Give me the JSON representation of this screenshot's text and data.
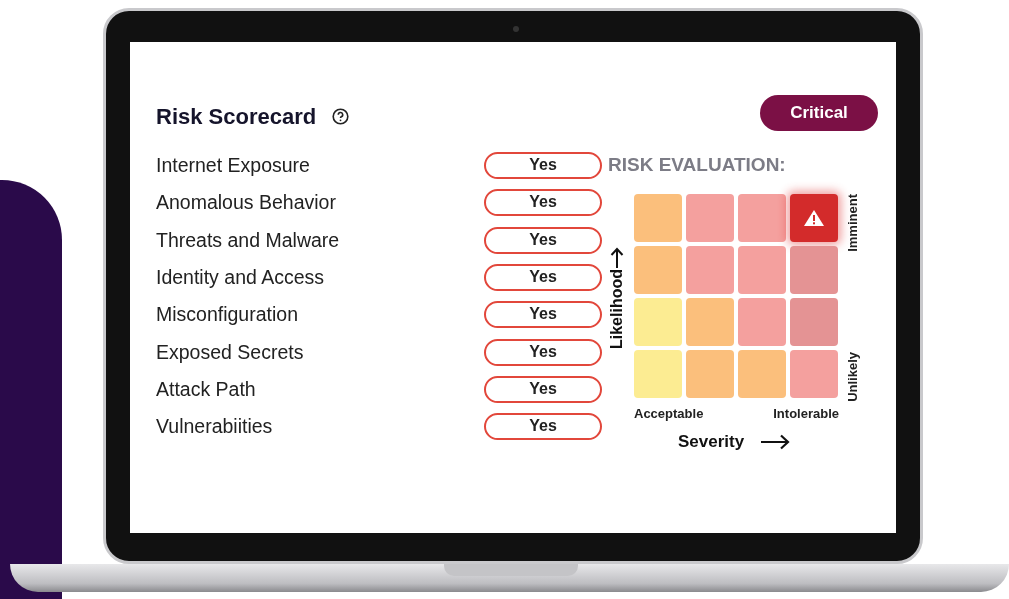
{
  "scorecard": {
    "title": "Risk Scorecard",
    "status": "Critical",
    "items": [
      {
        "label": "Internet Exposure",
        "value": "Yes"
      },
      {
        "label": "Anomalous Behavior",
        "value": "Yes"
      },
      {
        "label": "Threats and Malware",
        "value": "Yes"
      },
      {
        "label": "Identity and Access",
        "value": "Yes"
      },
      {
        "label": "Misconfiguration",
        "value": "Yes"
      },
      {
        "label": "Exposed Secrets",
        "value": "Yes"
      },
      {
        "label": "Attack Path",
        "value": "Yes"
      },
      {
        "label": "Vulnerabiities",
        "value": "Yes"
      }
    ]
  },
  "risk_evaluation": {
    "title": "RISK EVALUATION:",
    "y_label": "Likelihood",
    "x_label": "Severity",
    "top_label": "Imminent",
    "bottom_label": "Unlikely",
    "left_label": "Acceptable",
    "right_label": "Intolerable",
    "rows": [
      [
        {
          "color": "#fbbf7c",
          "alert": false
        },
        {
          "color": "#f4a09e",
          "alert": false
        },
        {
          "color": "#f4a09e",
          "alert": false
        },
        {
          "color": "#d32b2b",
          "alert": true
        }
      ],
      [
        {
          "color": "#fbbf7c",
          "alert": false
        },
        {
          "color": "#f4a09e",
          "alert": false
        },
        {
          "color": "#f4a09e",
          "alert": false
        },
        {
          "color": "#e49394",
          "alert": false
        }
      ],
      [
        {
          "color": "#fcec92",
          "alert": false
        },
        {
          "color": "#fbbf7c",
          "alert": false
        },
        {
          "color": "#f4a09e",
          "alert": false
        },
        {
          "color": "#e49394",
          "alert": false
        }
      ],
      [
        {
          "color": "#fcec92",
          "alert": false
        },
        {
          "color": "#fbbf7c",
          "alert": false
        },
        {
          "color": "#fbbf7c",
          "alert": false
        },
        {
          "color": "#f4a09e",
          "alert": false
        }
      ]
    ]
  }
}
